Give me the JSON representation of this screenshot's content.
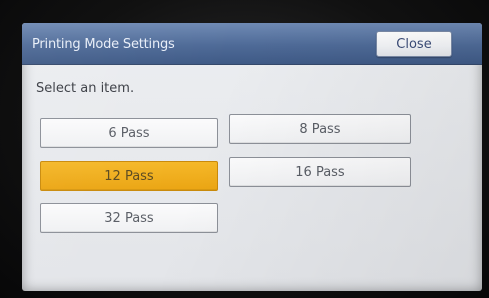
{
  "dialog": {
    "title": "Printing Mode Settings",
    "close_label": "Close",
    "prompt": "Select an item."
  },
  "options": [
    {
      "label": "6 Pass",
      "selected": false
    },
    {
      "label": "8 Pass",
      "selected": false
    },
    {
      "label": "12 Pass",
      "selected": true
    },
    {
      "label": "16 Pass",
      "selected": false
    },
    {
      "label": "32 Pass",
      "selected": false
    }
  ],
  "colors": {
    "title_bar": "#4e6a97",
    "selected": "#eba513",
    "background": "#e3e5e9"
  }
}
